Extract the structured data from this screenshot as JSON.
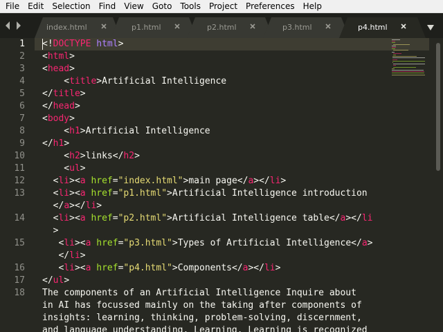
{
  "menu": [
    "File",
    "Edit",
    "Selection",
    "Find",
    "View",
    "Goto",
    "Tools",
    "Project",
    "Preferences",
    "Help"
  ],
  "tabs": [
    {
      "label": "index.html",
      "active": false
    },
    {
      "label": "p1.html",
      "active": false
    },
    {
      "label": "p2.html",
      "active": false
    },
    {
      "label": "p3.html",
      "active": false
    },
    {
      "label": "p4.html",
      "active": true
    }
  ],
  "editor": {
    "current_line": 1,
    "line_numbers": [
      "1",
      "2",
      "3",
      "4",
      "5",
      "6",
      "7",
      "8",
      "9",
      "10",
      "11",
      "12",
      "13",
      "14",
      "15",
      "16",
      "17",
      "18"
    ],
    "lines": [
      {
        "text": "<!DOCTYPE html>"
      },
      {
        "text": "<html>"
      },
      {
        "text": "<head>"
      },
      {
        "text": "    <title>Artificial Intelligence"
      },
      {
        "text": "</title>"
      },
      {
        "text": "</head>"
      },
      {
        "text": "<body>"
      },
      {
        "text": "    <h1>Artificial Intelligence"
      },
      {
        "text": "</h1>"
      },
      {
        "text": "    <h2>links</h2>"
      },
      {
        "text": "    <ul>"
      },
      {
        "text": "  <li><a href=\"index.html\">main page</a></li>"
      },
      {
        "text": "  <li><a href=\"p1.html\">Artificial Intelligence introduction"
      },
      {
        "text": "  </a></li>"
      },
      {
        "text": "  <li><a href=\"p2.html\">Artificial Intelligence table</a></li"
      },
      {
        "text": "  >"
      },
      {
        "text": "   <li><a href=\"p3.html\">Types of Artificial Intelligence</a>"
      },
      {
        "text": "   </li>"
      },
      {
        "text": "   <li><a href=\"p4.html\">Components</a></li>"
      },
      {
        "text": "</ul>"
      },
      {
        "text": "The components of an Artificial Intelligence Inquire about"
      },
      {
        "text": "in AI has focussed mainly on the taking after components of"
      },
      {
        "text": "insights: learning, thinking, problem-solving, discernment,"
      },
      {
        "text": "and language understanding. Learning. Learning is recognized"
      }
    ]
  },
  "colors": {
    "background": "#272822",
    "foreground": "#f8f8f2",
    "tag": "#f92672",
    "attribute": "#a6e22e",
    "string": "#e6db74",
    "doctype_name": "#ae81ff",
    "gutter_text": "#90908a",
    "tabbar": "#1e1f1b"
  },
  "icons": {
    "tab_prev": "chevron-left-icon",
    "tab_next": "chevron-right-icon",
    "tab_close": "close-icon",
    "tab_list": "triangle-down-icon"
  }
}
